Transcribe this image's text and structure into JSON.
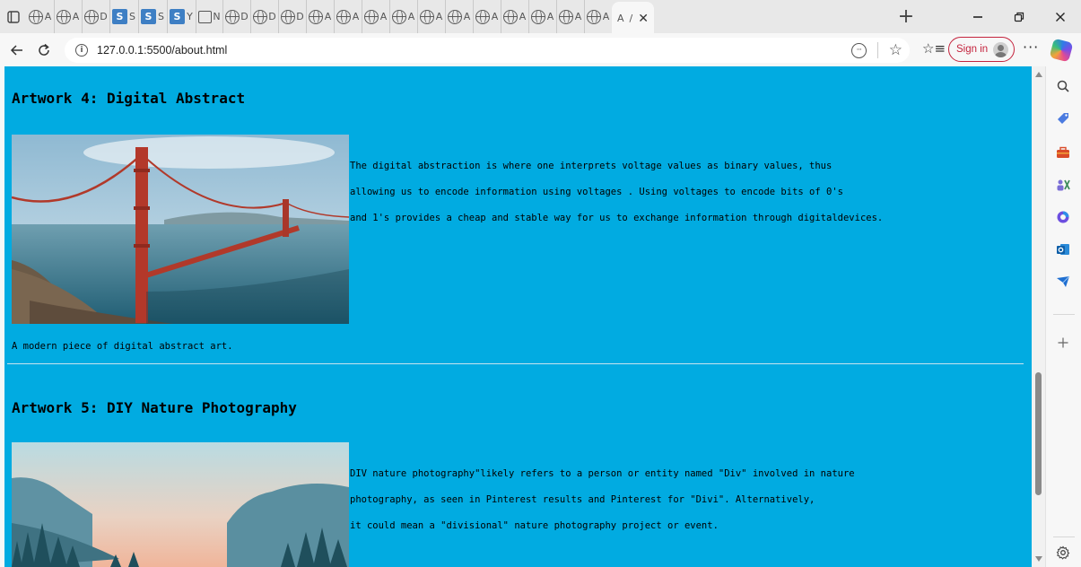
{
  "browser": {
    "tab_letters": [
      "A",
      "A",
      "D",
      "S",
      "S",
      "Y",
      "N",
      "D",
      "D",
      "D",
      "A",
      "A",
      "A",
      "A",
      "A",
      "A",
      "A",
      "A",
      "A",
      "A",
      "A"
    ],
    "s_tab_letters": [
      "S",
      "S",
      "S"
    ],
    "y_icon_label": "",
    "active_tab_letter": "A",
    "active_tab_suffix": "/",
    "new_tab_icon": "+",
    "url": "127.0.0.1:5500/about.html",
    "sign_in_label": "Sign in",
    "more_label": "···"
  },
  "page": {
    "artwork4": {
      "heading": "Artwork 4: Digital Abstract",
      "description_lines": [
        "The digital abstraction is where one interprets voltage values as binary values, thus",
        " allowing us to encode information using voltages . Using voltages to encode bits of 0's",
        " and 1's provides a cheap and stable way for us to exchange information through digitaldevices."
      ],
      "caption": "A modern piece of digital abstract art."
    },
    "artwork5": {
      "heading": "Artwork 5: DIY Nature Photography",
      "description_lines": [
        " DIV nature photography\"likely refers to a person or entity named \"Div\" involved in nature",
        "   photography, as seen in Pinterest results and Pinterest for \"Divi\". Alternatively,",
        " it could mean a \"divisional\" nature photography project or event."
      ]
    }
  },
  "colors": {
    "page_background": "#01abe1",
    "sign_in_accent": "#c4233d"
  },
  "icons": {
    "tab_actions": "tab-actions-icon",
    "back": "back-arrow-icon",
    "refresh": "refresh-icon",
    "site_info": "info-icon",
    "reading_view": "immersive-reader-icon",
    "favorite": "star-icon",
    "favorites_list": "favorites-icon",
    "copilot": "copilot-icon",
    "sidebar": [
      "search-icon",
      "shopping-tag-icon",
      "toolbox-icon",
      "people-icon",
      "office-icon",
      "outlook-icon",
      "telegram-icon",
      "add-icon",
      "settings-icon"
    ]
  }
}
